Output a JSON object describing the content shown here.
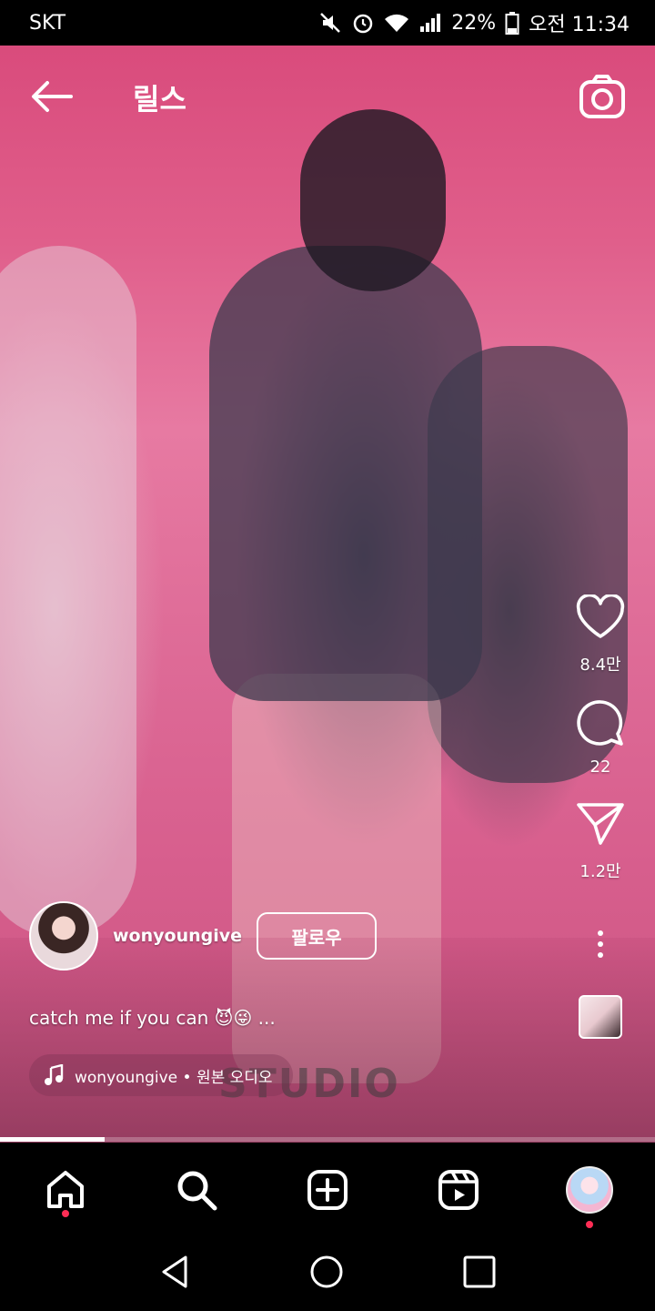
{
  "status_bar": {
    "carrier": "SKT",
    "battery": "22%",
    "time": "오전 11:34",
    "icons": [
      "mute-icon",
      "alarm-icon",
      "wifi-icon",
      "signal-icon",
      "battery-icon"
    ]
  },
  "header": {
    "title": "릴스",
    "back_icon": "arrow-left-icon",
    "camera_icon": "camera-icon"
  },
  "video": {
    "watermark": "STUDIO",
    "progress": 0.16
  },
  "actions": {
    "like_count": "8.4만",
    "comment_count": "22",
    "share_count": "1.2만"
  },
  "author": {
    "username": "wonyoungive",
    "follow_label": "팔로우"
  },
  "caption": "catch me if you can 😈😜 ...",
  "audio": {
    "label": "wonyoungive • 원본 오디오"
  },
  "bottom_nav": {
    "items": [
      "home-icon",
      "search-icon",
      "add-icon",
      "reels-icon",
      "profile-avatar"
    ]
  },
  "system_nav": [
    "back-icon",
    "home-icon",
    "recents-icon"
  ],
  "colors": {
    "notification_dot": "#ff2d55",
    "background": "#000000"
  }
}
